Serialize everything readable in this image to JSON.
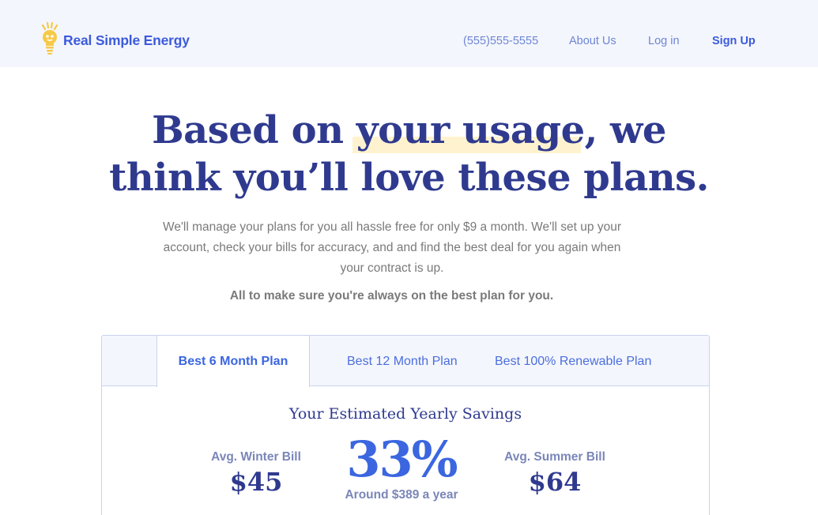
{
  "header": {
    "brand": "Real Simple Energy",
    "nav": {
      "phone": "(555)555-5555",
      "about": "About Us",
      "login": "Log in",
      "signup": "Sign Up"
    }
  },
  "hero": {
    "headline_line1_pre": "Based on ",
    "headline_line1_highlight": "your usage,",
    "headline_line1_post": " we",
    "headline_line2": "think you’ll love these plans.",
    "description": "We'll manage your plans for you all hassle free for only $9 a month. We'll set up your account, check your bills for accuracy, and and find the best deal for you again when your contract is up.",
    "tagline": "All to make sure you're always on the best plan for you."
  },
  "plans": {
    "tabs": [
      {
        "label": "Best 6 Month Plan",
        "active": true
      },
      {
        "label": "Best 12 Month Plan",
        "active": false
      },
      {
        "label": "Best 100% Renewable Plan",
        "active": false
      }
    ],
    "savings_title": "Your Estimated Yearly Savings",
    "winter_label": "Avg. Winter Bill",
    "winter_amount": "$45",
    "savings_percent": "33%",
    "savings_around": "Around $389 a year",
    "summer_label": "Avg. Summer Bill",
    "summer_amount": "$64"
  },
  "colors": {
    "brand_blue": "#3b5bdb",
    "headline_navy": "#2f3a8f",
    "highlight_yellow": "#fff3cf",
    "logo_bulb": "#f7c948"
  },
  "icons": {
    "logo": "lightbulb-icon"
  }
}
